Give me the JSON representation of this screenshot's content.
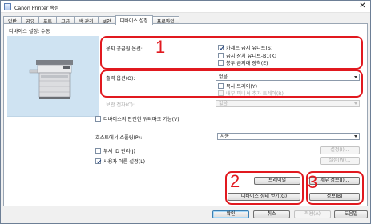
{
  "window": {
    "title": "Canon Printer 속성",
    "close_glyph": "✕"
  },
  "tabs": [
    {
      "label": "일반",
      "active": false
    },
    {
      "label": "공유",
      "active": false
    },
    {
      "label": "포트",
      "active": false
    },
    {
      "label": "고급",
      "active": false
    },
    {
      "label": "색 관리",
      "active": false
    },
    {
      "label": "보안",
      "active": false
    },
    {
      "label": "디바이스 설정",
      "active": true
    },
    {
      "label": "프로파일",
      "active": false
    }
  ],
  "device": {
    "status_label": "디바이스 설정: 수동"
  },
  "paper_source": {
    "label": "용지 공급원 옵션:",
    "options": [
      {
        "label": "카세트 급지 유니트(S)",
        "checked": true
      },
      {
        "label": "급지 장치 유니트-B1(K)",
        "checked": false
      },
      {
        "label": "봉투 급지대 장착(E)",
        "checked": false
      }
    ]
  },
  "output": {
    "label": "출력 옵션(O):",
    "select_value": "없음",
    "copy_tray": {
      "label": "복사 트레이(Y)",
      "checked": false
    },
    "inner_tray": {
      "label": "내부 피니셔 추가 트레이(R)",
      "checked": false,
      "disabled": true
    }
  },
  "storage": {
    "label": "보관 전자(C):",
    "select_value": "없음"
  },
  "secure_option": {
    "label": "디바이스의 안전한 워터마크 기능(V)",
    "checked": false
  },
  "spooling": {
    "label": "호스트에서 스풀링(P):",
    "select_value": "자동"
  },
  "dept_id": {
    "label": "부서 ID 관리(J)",
    "checked": false,
    "button": "설정(I)..."
  },
  "user_settings": {
    "label": "사용자 이름 설정(L)",
    "checked": true,
    "button": "설정(W)..."
  },
  "buttons": {
    "tray": "트레이별",
    "get_status": "디바이스 상태 얻기(G)",
    "details": "세부 정보(I)...",
    "info": "정보(B)"
  },
  "dialog": {
    "ok": "확인",
    "cancel": "취소",
    "apply": "적용(A)",
    "help": "도움말"
  },
  "callouts": [
    "1",
    "2",
    "3"
  ],
  "colors": {
    "callout_red": "#e1191f",
    "device_bg": "#cfe3f2",
    "accent_border": "#3c7fb1"
  }
}
